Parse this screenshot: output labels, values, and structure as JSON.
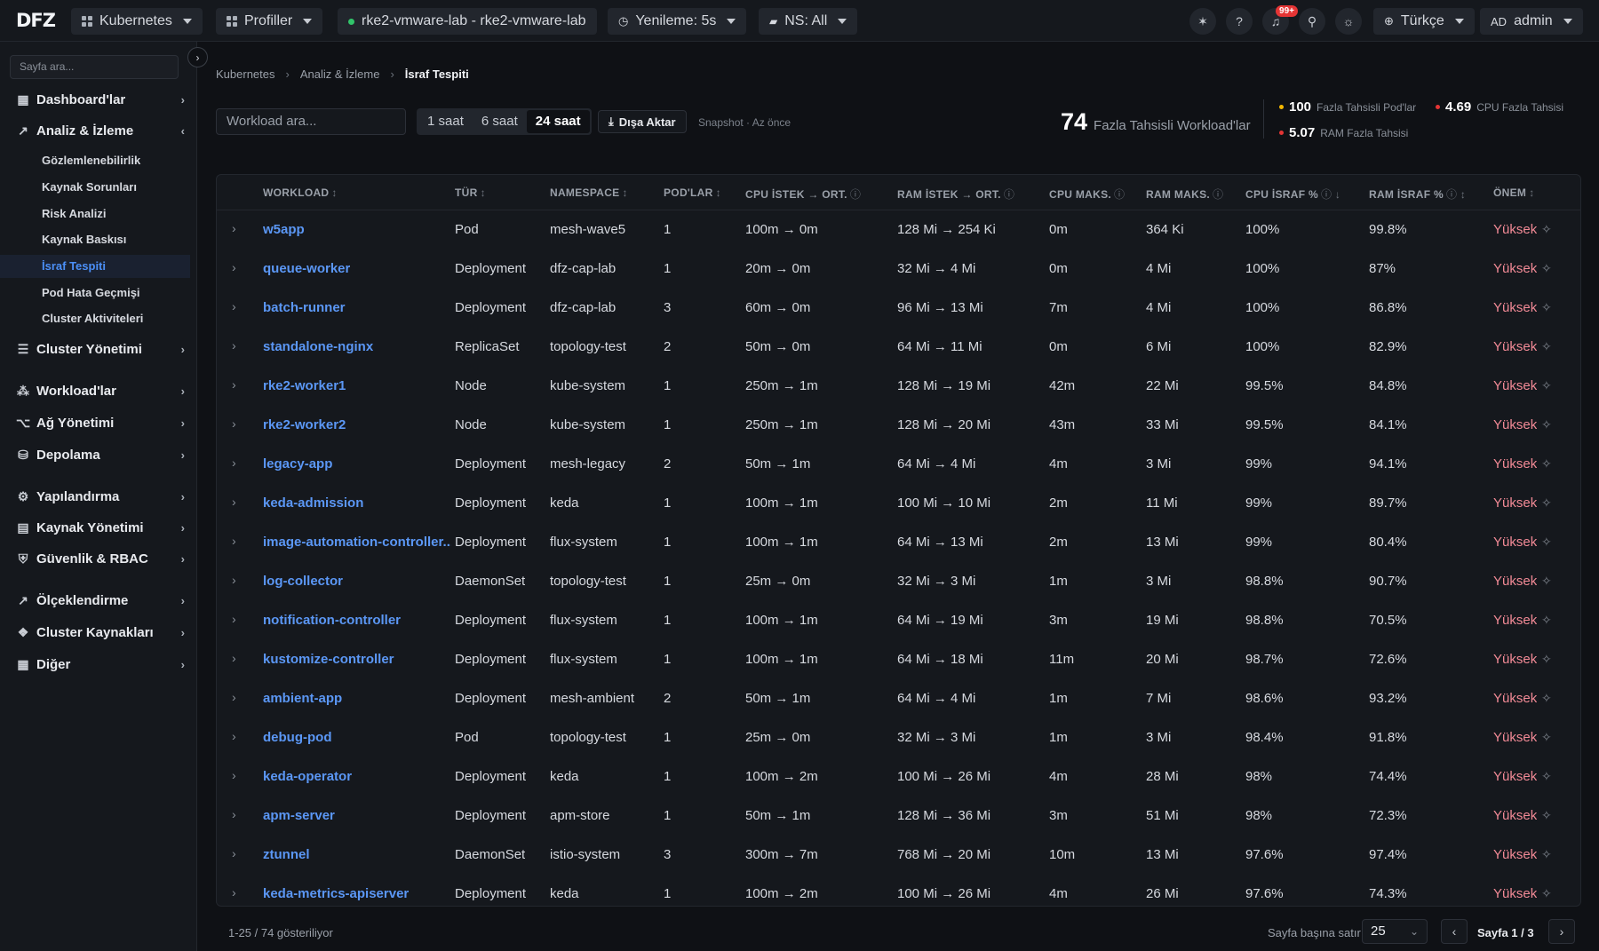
{
  "topbar": {
    "logo": "DFZ",
    "kubernetes": "Kubernetes",
    "profiles": "Profiller",
    "cluster": "rke2-vmware-lab - rke2-vmware-lab",
    "refresh": "Yenileme: 5s",
    "namespace": "NS: All",
    "notif_count": "99+",
    "language": "Türkçe",
    "user_initials": "AD",
    "user_name": "admin"
  },
  "sidebar": {
    "search_placeholder": "Sayfa ara...",
    "items": [
      {
        "label": "Dashboard'lar",
        "icon": "dashboard-icon"
      },
      {
        "label": "Analiz & İzleme",
        "icon": "chart-icon"
      },
      {
        "label": "Cluster Yönetimi",
        "icon": "server-icon"
      },
      {
        "label": "Workload'lar",
        "icon": "cubes-icon"
      },
      {
        "label": "Ağ Yönetimi",
        "icon": "network-icon"
      },
      {
        "label": "Depolama",
        "icon": "database-icon"
      },
      {
        "label": "Yapılandırma",
        "icon": "gear-icon"
      },
      {
        "label": "Kaynak Yönetimi",
        "icon": "resource-icon"
      },
      {
        "label": "Güvenlik & RBAC",
        "icon": "shield-icon"
      },
      {
        "label": "Ölçeklendirme",
        "icon": "trend-icon"
      },
      {
        "label": "Cluster Kaynakları",
        "icon": "cluster-icon"
      },
      {
        "label": "Diğer",
        "icon": "grid-icon"
      }
    ],
    "subitems": [
      "Gözlemlenebilirlik",
      "Kaynak Sorunları",
      "Risk Analizi",
      "Kaynak Baskısı",
      "İsraf Tespiti",
      "Pod Hata Geçmişi",
      "Cluster Aktiviteleri"
    ]
  },
  "breadcrumb": [
    "Kubernetes",
    "Analiz & İzleme",
    "İsraf Tespiti"
  ],
  "toolbar": {
    "search_placeholder": "Workload ara...",
    "ranges": [
      "1 saat",
      "6 saat",
      "24 saat"
    ],
    "active_range": "24 saat",
    "export_label": "Dışa Aktar",
    "snapshot": "Snapshot · Az önce"
  },
  "stats": {
    "total": "74",
    "total_label": "Fazla Tahsisli Workload'lar",
    "pods": "100",
    "pods_label": "Fazla Tahsisli Pod'lar",
    "cpu": "4.69",
    "cpu_label": "CPU Fazla Tahsisi",
    "ram": "5.07",
    "ram_label": "RAM Fazla Tahsisi",
    "color_yellow": "#f5b800",
    "color_red": "#e53535"
  },
  "table": {
    "headers": [
      "WORKLOAD",
      "TÜR",
      "NAMESPACE",
      "POD'LAR",
      "CPU İSTEK → ORT.",
      "RAM İSTEK → ORT.",
      "CPU MAKS.",
      "RAM MAKS.",
      "CPU İSRAF %",
      "RAM İSRAF %",
      "ÖNEM"
    ],
    "rows": [
      [
        "w5app",
        "Pod",
        "mesh-wave5",
        "1",
        "100m → 0m",
        "128 Mi → 254 Ki",
        "0m",
        "364 Ki",
        "100%",
        "99.8%",
        "Yüksek"
      ],
      [
        "queue-worker",
        "Deployment",
        "dfz-cap-lab",
        "1",
        "20m → 0m",
        "32 Mi → 4 Mi",
        "0m",
        "4 Mi",
        "100%",
        "87%",
        "Yüksek"
      ],
      [
        "batch-runner",
        "Deployment",
        "dfz-cap-lab",
        "3",
        "60m → 0m",
        "96 Mi → 13 Mi",
        "7m",
        "4 Mi",
        "100%",
        "86.8%",
        "Yüksek"
      ],
      [
        "standalone-nginx",
        "ReplicaSet",
        "topology-test",
        "2",
        "50m → 0m",
        "64 Mi → 11 Mi",
        "0m",
        "6 Mi",
        "100%",
        "82.9%",
        "Yüksek"
      ],
      [
        "rke2-worker1",
        "Node",
        "kube-system",
        "1",
        "250m → 1m",
        "128 Mi → 19 Mi",
        "42m",
        "22 Mi",
        "99.5%",
        "84.8%",
        "Yüksek"
      ],
      [
        "rke2-worker2",
        "Node",
        "kube-system",
        "1",
        "250m → 1m",
        "128 Mi → 20 Mi",
        "43m",
        "33 Mi",
        "99.5%",
        "84.1%",
        "Yüksek"
      ],
      [
        "legacy-app",
        "Deployment",
        "mesh-legacy",
        "2",
        "50m → 1m",
        "64 Mi → 4 Mi",
        "4m",
        "3 Mi",
        "99%",
        "94.1%",
        "Yüksek"
      ],
      [
        "keda-admission",
        "Deployment",
        "keda",
        "1",
        "100m → 1m",
        "100 Mi → 10 Mi",
        "2m",
        "11 Mi",
        "99%",
        "89.7%",
        "Yüksek"
      ],
      [
        "image-automation-controller...",
        "Deployment",
        "flux-system",
        "1",
        "100m → 1m",
        "64 Mi → 13 Mi",
        "2m",
        "13 Mi",
        "99%",
        "80.4%",
        "Yüksek"
      ],
      [
        "log-collector",
        "DaemonSet",
        "topology-test",
        "1",
        "25m → 0m",
        "32 Mi → 3 Mi",
        "1m",
        "3 Mi",
        "98.8%",
        "90.7%",
        "Yüksek"
      ],
      [
        "notification-controller",
        "Deployment",
        "flux-system",
        "1",
        "100m → 1m",
        "64 Mi → 19 Mi",
        "3m",
        "19 Mi",
        "98.8%",
        "70.5%",
        "Yüksek"
      ],
      [
        "kustomize-controller",
        "Deployment",
        "flux-system",
        "1",
        "100m → 1m",
        "64 Mi → 18 Mi",
        "11m",
        "20 Mi",
        "98.7%",
        "72.6%",
        "Yüksek"
      ],
      [
        "ambient-app",
        "Deployment",
        "mesh-ambient",
        "2",
        "50m → 1m",
        "64 Mi → 4 Mi",
        "1m",
        "7 Mi",
        "98.6%",
        "93.2%",
        "Yüksek"
      ],
      [
        "debug-pod",
        "Pod",
        "topology-test",
        "1",
        "25m → 0m",
        "32 Mi → 3 Mi",
        "1m",
        "3 Mi",
        "98.4%",
        "91.8%",
        "Yüksek"
      ],
      [
        "keda-operator",
        "Deployment",
        "keda",
        "1",
        "100m → 2m",
        "100 Mi → 26 Mi",
        "4m",
        "28 Mi",
        "98%",
        "74.4%",
        "Yüksek"
      ],
      [
        "apm-server",
        "Deployment",
        "apm-store",
        "1",
        "50m → 1m",
        "128 Mi → 36 Mi",
        "3m",
        "51 Mi",
        "98%",
        "72.3%",
        "Yüksek"
      ],
      [
        "ztunnel",
        "DaemonSet",
        "istio-system",
        "3",
        "300m → 7m",
        "768 Mi → 20 Mi",
        "10m",
        "13 Mi",
        "97.6%",
        "97.4%",
        "Yüksek"
      ],
      [
        "keda-metrics-apiserver",
        "Deployment",
        "keda",
        "1",
        "100m → 2m",
        "100 Mi → 26 Mi",
        "4m",
        "26 Mi",
        "97.6%",
        "74.3%",
        "Yüksek"
      ]
    ]
  },
  "footer": {
    "count": "1-25 / 74 gösteriliyor",
    "per_page_label": "Sayfa başına satır",
    "per_page": "25",
    "page": "Sayfa 1 / 3"
  }
}
